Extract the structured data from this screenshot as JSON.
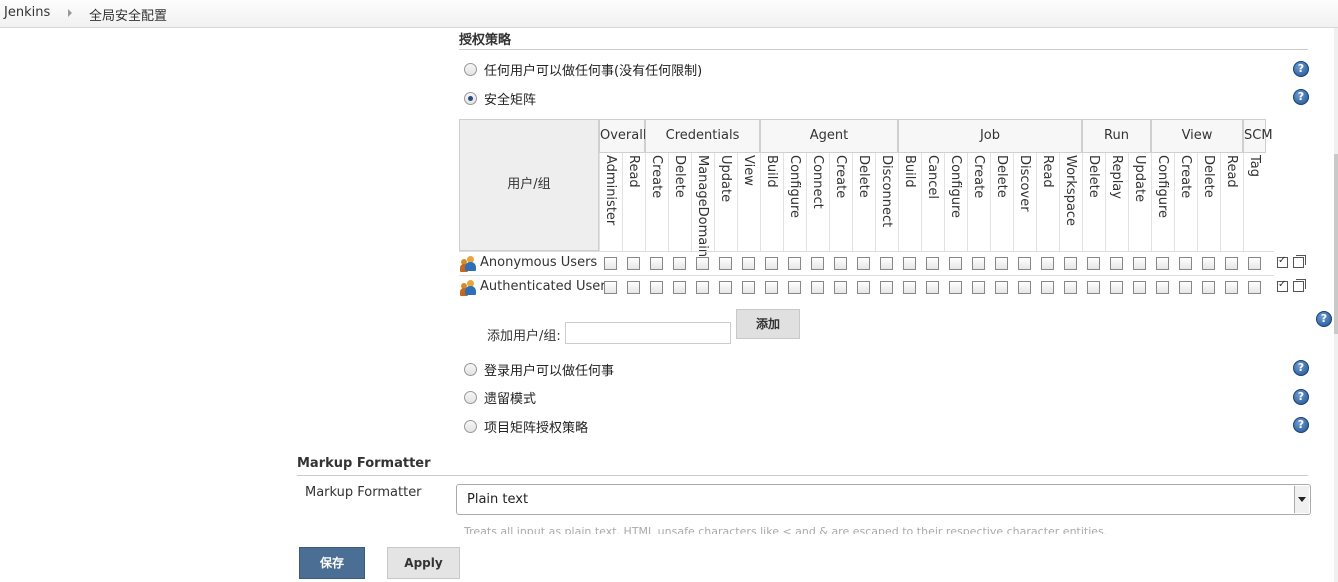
{
  "breadcrumb": {
    "root": "Jenkins",
    "current": "全局安全配置"
  },
  "authorization": {
    "title": "授权策略",
    "options": [
      {
        "label": "任何用户可以做任何事(没有任何限制)",
        "checked": false
      },
      {
        "label": "安全矩阵",
        "checked": true
      },
      {
        "label": "登录用户可以做任何事",
        "checked": false
      },
      {
        "label": "遗留模式",
        "checked": false
      },
      {
        "label": "项目矩阵授权策略",
        "checked": false
      }
    ]
  },
  "matrix": {
    "user_header": "用户/组",
    "groups": [
      {
        "name": "Overall",
        "permissions": [
          "Administer",
          "Read"
        ]
      },
      {
        "name": "Credentials",
        "permissions": [
          "Create",
          "Delete",
          "ManageDomains",
          "Update",
          "View"
        ]
      },
      {
        "name": "Agent",
        "permissions": [
          "Build",
          "Configure",
          "Connect",
          "Create",
          "Delete",
          "Disconnect"
        ]
      },
      {
        "name": "Job",
        "permissions": [
          "Build",
          "Cancel",
          "Configure",
          "Create",
          "Delete",
          "Discover",
          "Read",
          "Workspace"
        ]
      },
      {
        "name": "Run",
        "permissions": [
          "Delete",
          "Replay",
          "Update"
        ]
      },
      {
        "name": "View",
        "permissions": [
          "Configure",
          "Create",
          "Delete",
          "Read"
        ]
      },
      {
        "name": "SCM",
        "permissions": [
          "Tag"
        ]
      }
    ],
    "rows": [
      {
        "name": "Anonymous Users"
      },
      {
        "name": "Authenticated Users"
      }
    ]
  },
  "add_user": {
    "label": "添加用户/组:",
    "value": "",
    "button": "添加"
  },
  "markup_formatter": {
    "section_title": "Markup Formatter",
    "label": "Markup Formatter",
    "selected": "Plain text",
    "description": "Treats all input as plain text. HTML unsafe characters like < and & are escaped to their respective character entities."
  },
  "buttons": {
    "save": "保存",
    "apply": "Apply"
  },
  "icons": {
    "help": "help-icon",
    "user": "user-group-icon",
    "check_all": "check-all-icon",
    "clear": "clear-icon"
  },
  "colors": {
    "primary_button": "#4b6e94",
    "help_icon": "#1f4f8f"
  }
}
